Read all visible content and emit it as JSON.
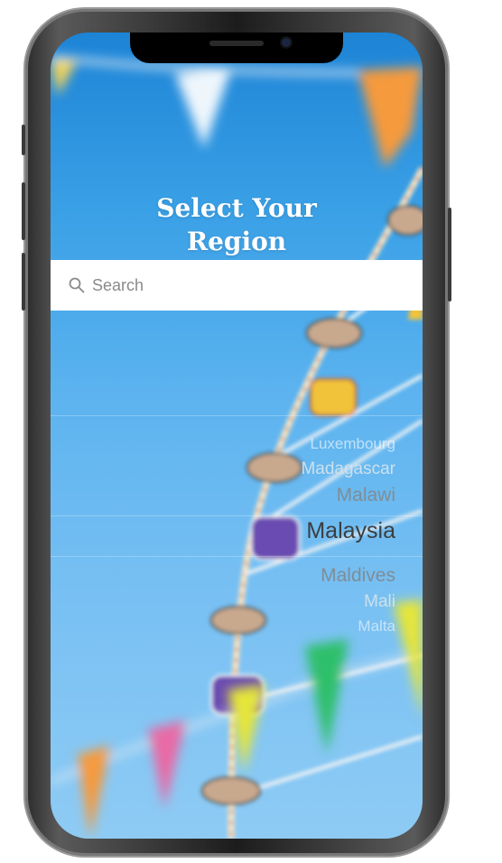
{
  "header": {
    "title_line1": "Select Your",
    "title_line2": "Region"
  },
  "search": {
    "placeholder": "Search",
    "value": ""
  },
  "picker": {
    "items": [
      {
        "label": "Luxembourg"
      },
      {
        "label": "Madagascar"
      },
      {
        "label": "Malawi"
      },
      {
        "label": "Malaysia",
        "selected": true
      },
      {
        "label": "Maldives"
      },
      {
        "label": "Mali"
      },
      {
        "label": "Malta"
      }
    ]
  },
  "colors": {
    "sky_top": "#1d84d6",
    "sky_bottom": "#8ecbf4",
    "title_text": "#ffffff",
    "selected_text": "#3d3d3d"
  }
}
